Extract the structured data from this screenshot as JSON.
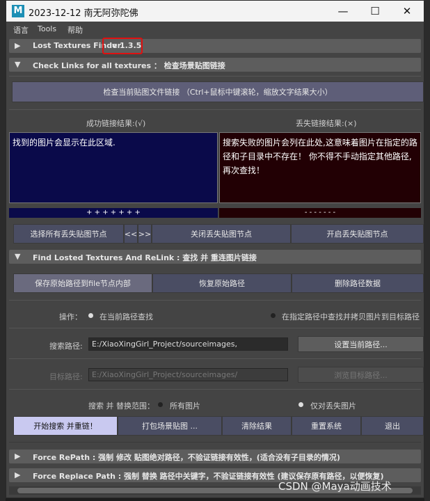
{
  "window": {
    "logo": "M",
    "title": "2023-12-12  南无阿弥陀佛",
    "minimize": "—",
    "maximize": "☐",
    "close": "✕"
  },
  "menu": [
    "语言",
    "Tools",
    "帮助"
  ],
  "frames": {
    "lost": "Lost Textures Finder",
    "version": "v 1.3.5",
    "check": "Check Links for all textures ： 检查场景贴图链接",
    "find": "Find Losted Textures  And  ReLink : 查找 并 重连图片链接",
    "force_repath": "Force RePath : 强制 修改 贴图绝对路径，不验证链接有效性，(适合没有子目录的情况)",
    "force_replace": "Force Replace Path : 强制 替换 路径中关键字，不验证链接有效性 (建议保存原有路径，以便恢复)"
  },
  "check_button": "检查当前贴图文件链接  （Ctrl+鼠标中键滚轮，缩放文字结果大小）",
  "results": {
    "ok_label": "成功链接结果:(√)",
    "lost_label": "丢失链接结果:(×)",
    "ok_text": "找到的图片会显示在此区域.",
    "lost_text": "搜索失败的图片会列在此处,这意味着图片在指定的路径和子目录中不存在！ 你不得不手动指定其他路径,再次查找！",
    "ok_bar": "+ + + + + + +",
    "lost_bar": "- - - - - - -"
  },
  "node_buttons": {
    "select_all": "选择所有丢失贴图节点",
    "prev": "<<",
    "next": ">>",
    "close_lost": "关闭丢失贴图节点",
    "open_lost": "开启丢失贴图节点"
  },
  "path_buttons": {
    "save": "保存原始路径到file节点内部",
    "restore": "恢复原始路径",
    "delete": "删除路径数据"
  },
  "operation": {
    "label": "操作：",
    "opt1": "在当前路径查找",
    "opt2": "在指定路径中查找并拷贝图片到目标路径"
  },
  "search": {
    "label": "搜索路径:",
    "value": "E:/XiaoXingGirl_Project/sourceimages,",
    "button": "设置当前路径..."
  },
  "target": {
    "label": "目标路径:",
    "value": "E:/XiaoXingGirl_Project/sourceimages/",
    "button": "浏览目标路径..."
  },
  "scope": {
    "label": "搜索 并 替换范围：",
    "opt1": "所有图片",
    "opt2": "仅对丢失图片"
  },
  "actions": {
    "start": "开始搜索 并重链！",
    "pack": "打包场景贴图 ...",
    "clear": "清除结果",
    "reset": "重置系统",
    "exit": "退出"
  },
  "watermark": "CSDN @Maya动画技术"
}
